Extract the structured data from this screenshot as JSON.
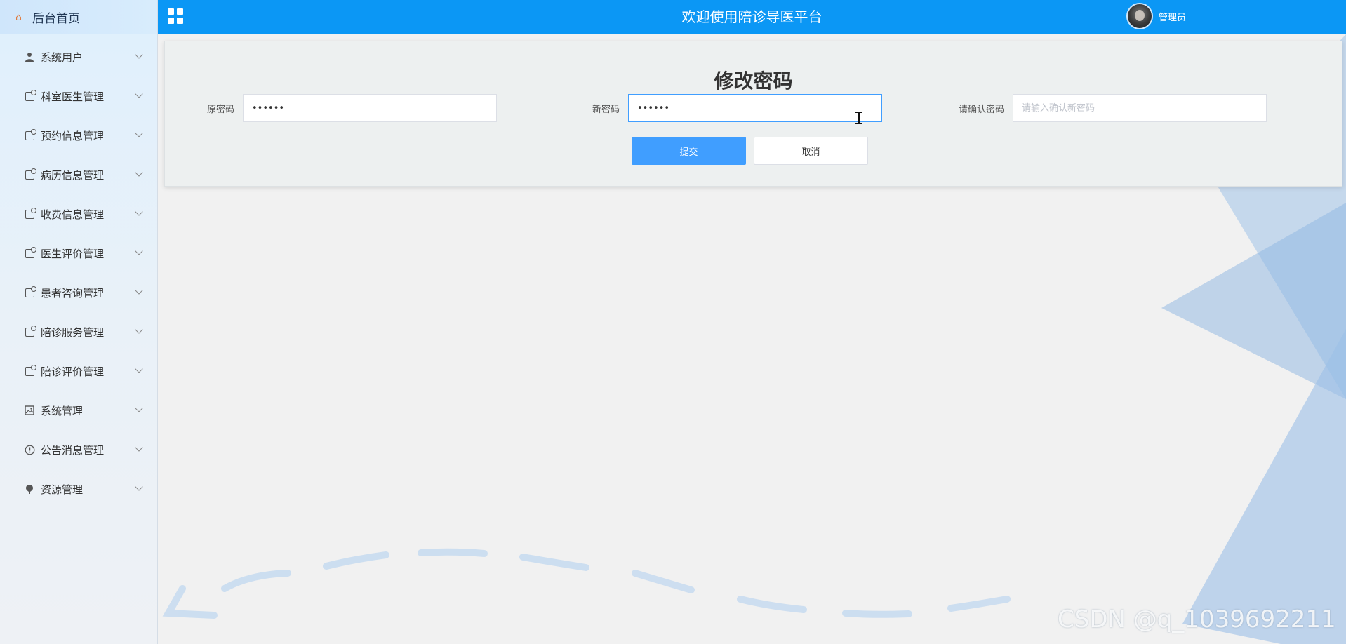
{
  "sidebar": {
    "home_label": "后台首页",
    "items": [
      {
        "label": "系统用户",
        "icon": "user-icon"
      },
      {
        "label": "科室医生管理",
        "icon": "document-icon"
      },
      {
        "label": "预约信息管理",
        "icon": "document-icon"
      },
      {
        "label": "病历信息管理",
        "icon": "document-icon"
      },
      {
        "label": "收费信息管理",
        "icon": "document-icon"
      },
      {
        "label": "医生评价管理",
        "icon": "document-icon"
      },
      {
        "label": "患者咨询管理",
        "icon": "document-icon"
      },
      {
        "label": "陪诊服务管理",
        "icon": "document-icon"
      },
      {
        "label": "陪诊评价管理",
        "icon": "document-icon"
      },
      {
        "label": "系统管理",
        "icon": "picture-icon"
      },
      {
        "label": "公告消息管理",
        "icon": "info-circle-icon"
      },
      {
        "label": "资源管理",
        "icon": "pin-icon"
      }
    ]
  },
  "header": {
    "title": "欢迎使用陪诊导医平台",
    "username": "管理员"
  },
  "form": {
    "title": "修改密码",
    "old_password": {
      "label": "原密码",
      "value": "••••••"
    },
    "new_password": {
      "label": "新密码",
      "value": "••••••"
    },
    "confirm_password": {
      "label": "请确认密码",
      "placeholder": "请输入确认新密码",
      "value": ""
    },
    "submit_label": "提交",
    "cancel_label": "取消"
  },
  "watermark": "CSDN @q_1039692211",
  "colors": {
    "header": "#0b97f5",
    "primary_button": "#409eff",
    "sidebar": "#e4f0fa"
  }
}
